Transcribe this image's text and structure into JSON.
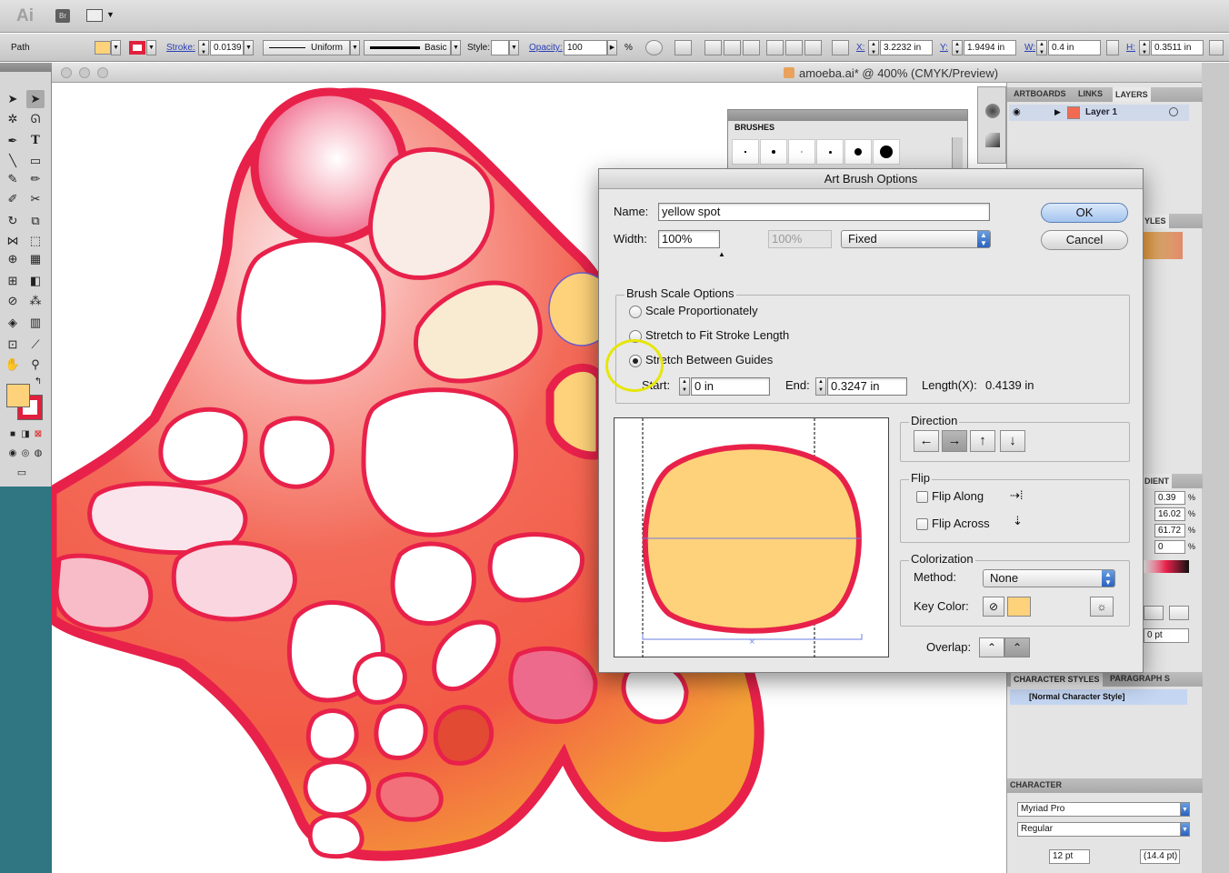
{
  "app": {
    "logo": "Ai",
    "bridge_label": "Br"
  },
  "control_bar": {
    "selection_type": "Path",
    "stroke_label": "Stroke:",
    "stroke_value": "0.0139",
    "profile_label": "Uniform",
    "brush_label": "Basic",
    "style_label": "Style:",
    "opacity_label": "Opacity:",
    "opacity_value": "100",
    "opacity_unit": "%",
    "x_label": "X:",
    "x_value": "3.2232 in",
    "y_label": "Y:",
    "y_value": "1.9494 in",
    "w_label": "W:",
    "w_value": "0.4 in",
    "h_label": "H:",
    "h_value": "0.3511 in",
    "fill_color": "#fdd27a",
    "stroke_color": "#e0203c"
  },
  "document": {
    "title": "amoeba.ai* @ 400% (CMYK/Preview)"
  },
  "colors": {
    "amoeba_outline": "#e8214a",
    "amoeba_fill": "#f36a52",
    "spot_yellow": "#fdd27a",
    "teal_background": "#2f7682",
    "highlight": "#e6e60a"
  },
  "brushes_panel": {
    "tab": "BRUSHES"
  },
  "layers_panel": {
    "tabs": [
      "ARTBOARDS",
      "LINKS",
      "LAYERS"
    ],
    "layer_name": "Layer 1"
  },
  "right_panels": {
    "styles_tab": "YLES",
    "gradient_tab": "DIENT",
    "color_values": [
      "0.39",
      "16.02",
      "61.72",
      "0"
    ],
    "percent": "%",
    "pt_value": "0 pt",
    "char_styles_tabs": [
      "CHARACTER STYLES",
      "PARAGRAPH S"
    ],
    "char_style_item": "[Normal Character Style]",
    "character_title": "CHARACTER",
    "font_family": "Myriad Pro",
    "font_style": "Regular",
    "font_size": "12 pt",
    "leading": "(14.4 pt)"
  },
  "dialog": {
    "title": "Art Brush Options",
    "name_label": "Name:",
    "name_value": "yellow spot",
    "width_label": "Width:",
    "width_value": "100%",
    "width_disabled_value": "100%",
    "width_mode": "Fixed",
    "ok_label": "OK",
    "cancel_label": "Cancel",
    "scale_group_label": "Brush Scale Options",
    "scale_options": [
      "Scale Proportionately",
      "Stretch to Fit Stroke Length",
      "Stretch Between Guides"
    ],
    "selected_scale_option": "Stretch Between Guides",
    "start_label": "Start:",
    "start_value": "0 in",
    "end_label": "End:",
    "end_value": "0.3247 in",
    "length_label": "Length(X):",
    "length_value": "0.4139 in",
    "direction_label": "Direction",
    "direction_selected": "right",
    "flip_label": "Flip",
    "flip_along_label": "Flip Along",
    "flip_across_label": "Flip Across",
    "colorization_label": "Colorization",
    "method_label": "Method:",
    "method_value": "None",
    "key_color_label": "Key Color:",
    "key_color": "#fdd27a",
    "overlap_label": "Overlap:"
  }
}
